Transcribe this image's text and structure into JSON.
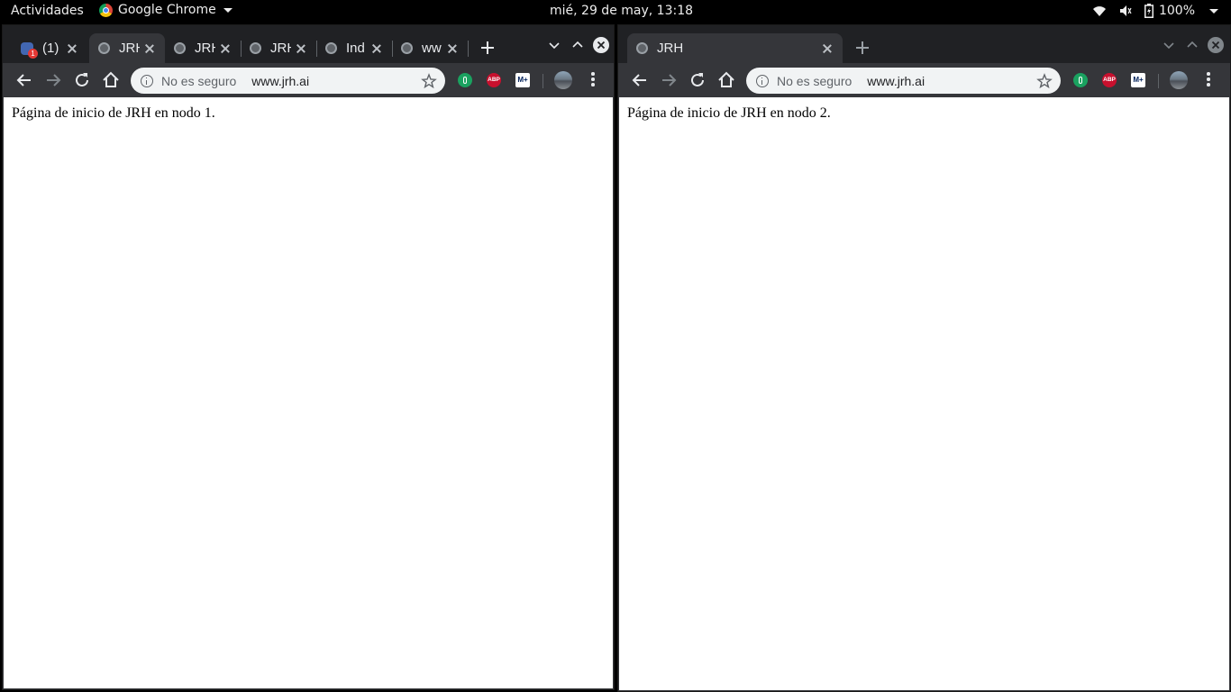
{
  "topbar": {
    "activities": "Actividades",
    "app_name": "Google Chrome",
    "clock": "mié, 29 de may, 13:18",
    "battery": "100%",
    "icons": [
      "wifi-icon",
      "volume-icon",
      "battery-icon",
      "system-menu-caret-icon"
    ]
  },
  "windows": [
    {
      "tabs": [
        {
          "title": "(1)",
          "icon": "facebook-icon",
          "badge": "1",
          "active": false
        },
        {
          "title": "JRH",
          "icon": "globe-icon",
          "active": true
        },
        {
          "title": "JRH",
          "icon": "globe-icon",
          "active": false
        },
        {
          "title": "JRH",
          "icon": "globe-icon",
          "active": false
        },
        {
          "title": "Ind",
          "icon": "globe-icon",
          "active": false
        },
        {
          "title": "ww",
          "icon": "globe-icon",
          "active": false
        }
      ],
      "omnibox": {
        "security": "No es seguro",
        "url": "www.jrh.ai"
      },
      "extensions": {
        "abp": "ABP",
        "movistar": "M+"
      },
      "page_text": "Página de inicio de JRH en nodo 1."
    },
    {
      "tabs": [
        {
          "title": "JRH",
          "icon": "globe-icon",
          "active": true
        }
      ],
      "omnibox": {
        "security": "No es seguro",
        "url": "www.jrh.ai"
      },
      "extensions": {
        "abp": "ABP",
        "movistar": "M+"
      },
      "page_text": "Página de inicio de JRH en nodo 2."
    }
  ],
  "colors": {
    "topbar_bg": "#000000",
    "tabstrip_bg": "#202124",
    "toolbar_bg": "#35363a",
    "omnibox_bg": "#f1f3f4",
    "page_bg": "#ffffff"
  }
}
